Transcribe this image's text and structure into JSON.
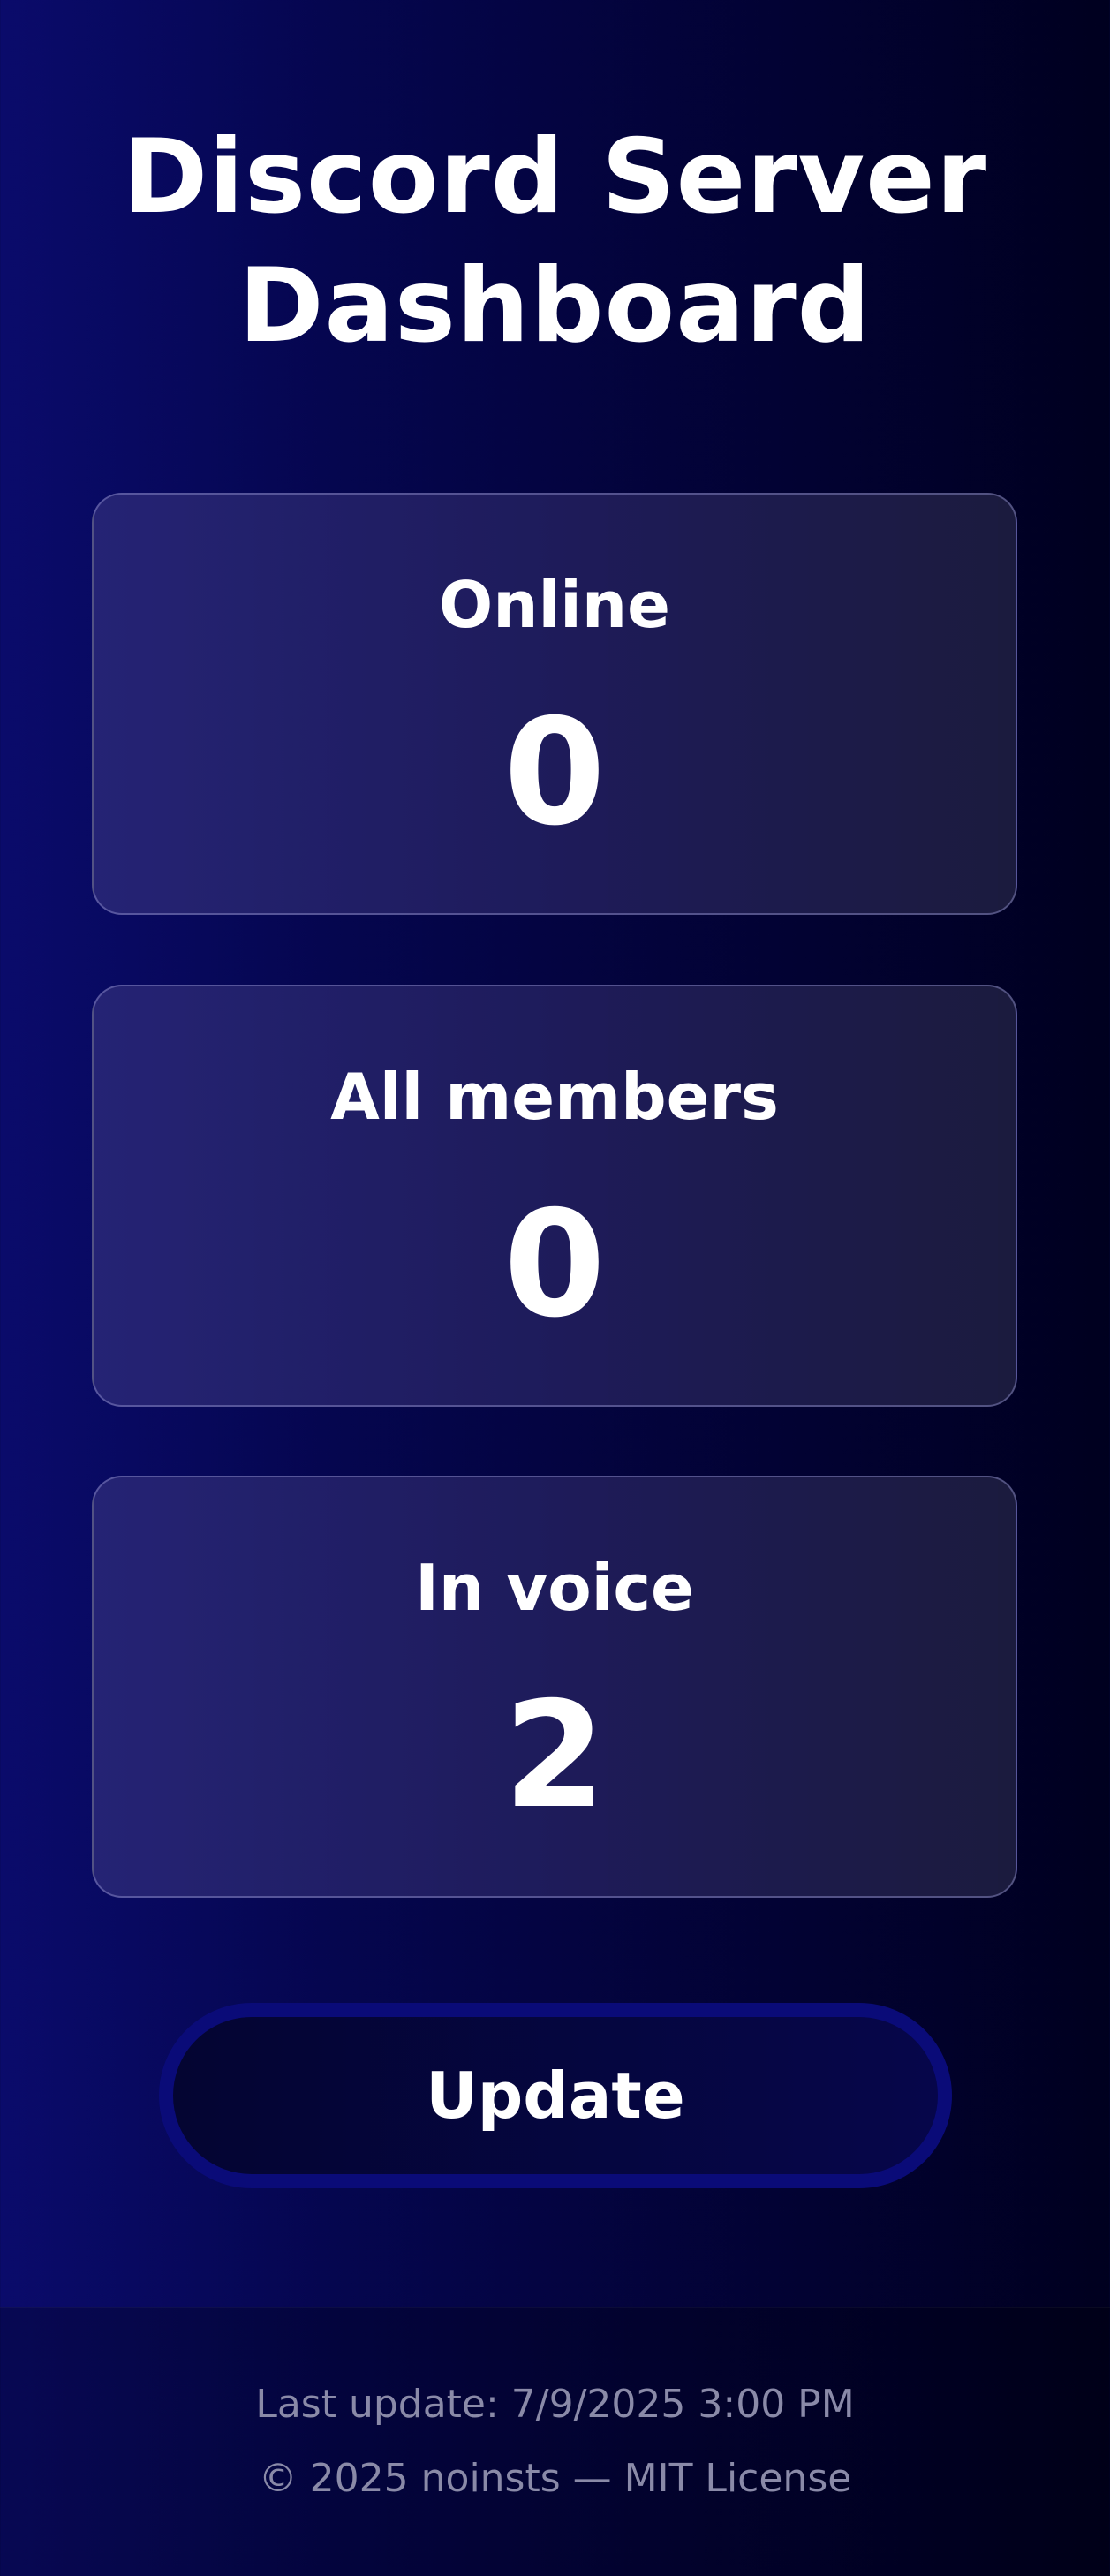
{
  "header": {
    "title": "Discord Server Dashboard"
  },
  "stats": [
    {
      "label": "Online",
      "value": "0"
    },
    {
      "label": "All members",
      "value": "0"
    },
    {
      "label": "In voice",
      "value": "2"
    }
  ],
  "actions": {
    "update_label": "Update"
  },
  "footer": {
    "last_update": "Last update: 7/9/2025 3:00 PM",
    "copyright": "© 2025 noinsts — MIT License"
  },
  "colors": {
    "background_left": "#0a0b6b",
    "background_right": "#00001f",
    "button_border": "#0a0b78",
    "footer_text": "#8a8aa8"
  }
}
